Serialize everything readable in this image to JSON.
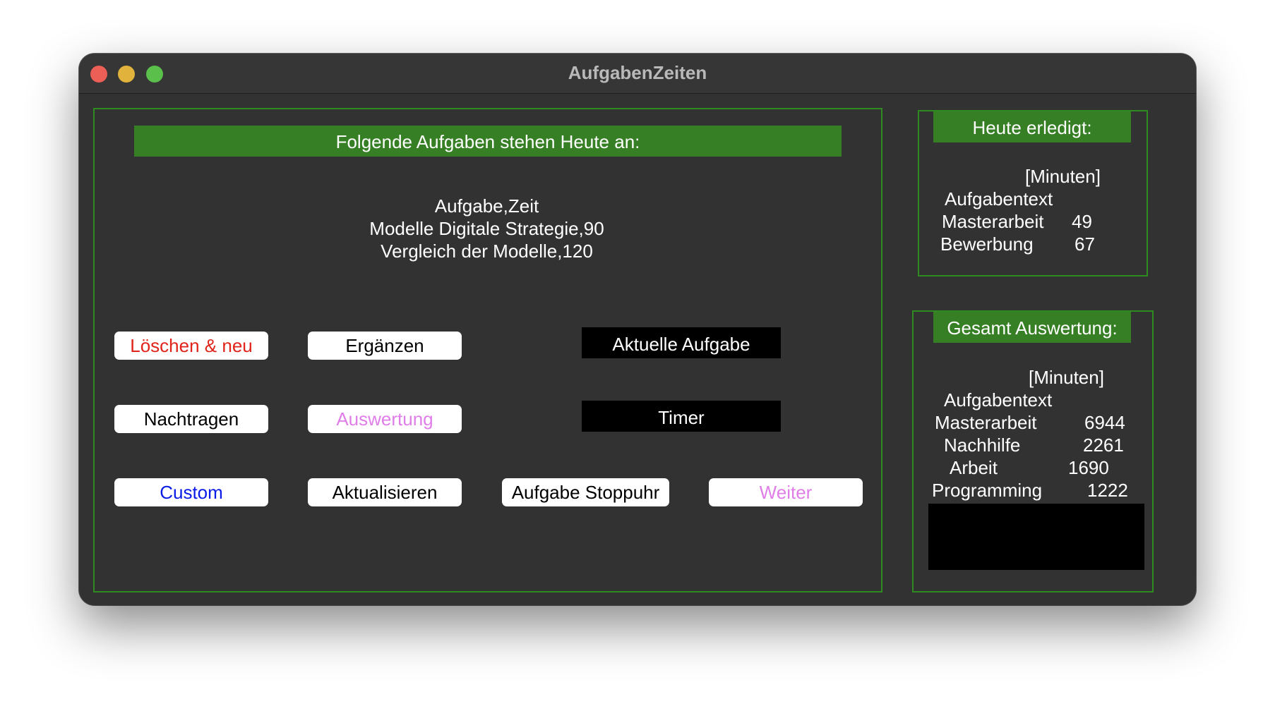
{
  "window": {
    "title": "AufgabenZeiten"
  },
  "tasks_panel": {
    "header": "Folgende Aufgaben stehen Heute an:",
    "lines": [
      "Aufgabe,Zeit",
      "Modelle Digitale Strategie,90",
      "Vergleich der Modelle,120"
    ]
  },
  "buttons": {
    "loeschen": {
      "label": "Löschen & neu",
      "color": "#e0241b"
    },
    "ergaenzen": {
      "label": "Ergänzen",
      "color": "#000000"
    },
    "nachtragen": {
      "label": "Nachtragen",
      "color": "#000000"
    },
    "auswertung": {
      "label": "Auswertung",
      "color": "#e07ee8"
    },
    "custom": {
      "label": "Custom",
      "color": "#0a1ce6"
    },
    "aktualisieren": {
      "label": "Aktualisieren",
      "color": "#000000"
    },
    "stoppuhr": {
      "label": "Aufgabe Stoppuhr",
      "color": "#000000"
    },
    "weiter": {
      "label": "Weiter",
      "color": "#e07ee8"
    }
  },
  "current_task": {
    "label": "Aktuelle Aufgabe"
  },
  "timer": {
    "label": "Timer"
  },
  "today": {
    "header": "Heute erledigt:",
    "unit": "[Minuten]",
    "column": "Aufgabentext",
    "rows": [
      {
        "task": "Masterarbeit",
        "minutes": "49"
      },
      {
        "task": "Bewerbung",
        "minutes": "67"
      }
    ]
  },
  "total": {
    "header": "Gesamt Auswertung:",
    "unit": "[Minuten]",
    "column": "Aufgabentext",
    "rows": [
      {
        "task": "Masterarbeit",
        "minutes": "6944"
      },
      {
        "task": "Nachhilfe",
        "minutes": "2261"
      },
      {
        "task": "Arbeit",
        "minutes": "1690"
      },
      {
        "task": "Programming",
        "minutes": "1222"
      }
    ]
  },
  "colors": {
    "window_bg": "#323232",
    "frame_green": "#2f8a22",
    "header_green": "#367f24"
  }
}
